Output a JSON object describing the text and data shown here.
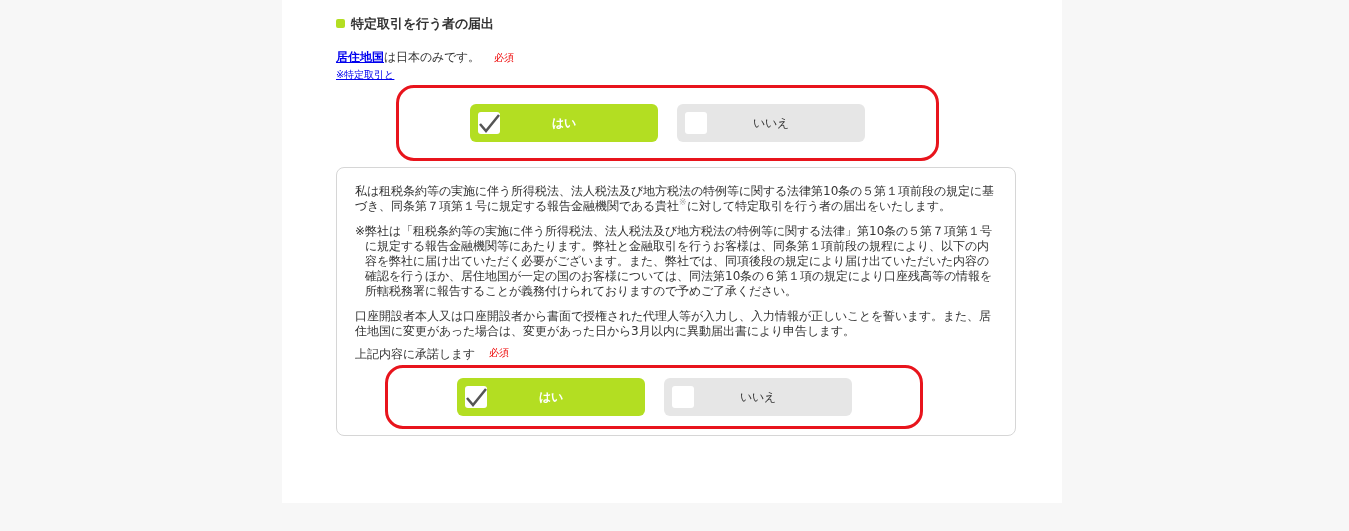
{
  "section": {
    "title": "特定取引を行う者の届出"
  },
  "residence": {
    "link": "居住地国",
    "text": "は日本のみです。",
    "required": "必須",
    "note_link": "※特定取引と",
    "options": [
      {
        "label": "はい",
        "selected": true
      },
      {
        "label": "いいえ",
        "selected": false
      }
    ]
  },
  "agreement": {
    "paragraphs": [
      "私は租税条約等の実施に伴う所得税法、法人税法及び地方税法の特例等に関する法律第10条の５第１項前段の規定に基づき、同条第７項第１号に規定する報告金融機関である貴社$^{※}$に対して特定取引を行う者の届出をいたします。"
    ],
    "note": "※弊社は「租税条約等の実施に伴う所得税法、法人税法及び地方税法の特例等に関する法律」第10条の５第７項第１号に規定する報告金融機関等にあたります。弊社と金融取引を行うお客様は、同条第１項前段の規程により、以下の内容を弊社に届け出ていただく必要がございます。また、弊社では、同項後段の規定により届け出ていただいた内容の確認を行うほか、居住地国が一定の国のお客様については、同法第10条の６第１項の規定により口座残高等の情報を所轄税務署に報告することが義務付けられておりますので予めご了承ください。",
    "pledge": "口座開設者本人又は口座開設者から書面で授権された代理人等が入力し、入力情報が正しいことを誓います。また、居住地国に変更があった場合は、変更があった日から3月以内に異動届出書により申告します。",
    "label": "上記内容に承諾します",
    "required": "必須",
    "options": [
      {
        "label": "はい",
        "selected": true
      },
      {
        "label": "いいえ",
        "selected": false
      }
    ]
  }
}
